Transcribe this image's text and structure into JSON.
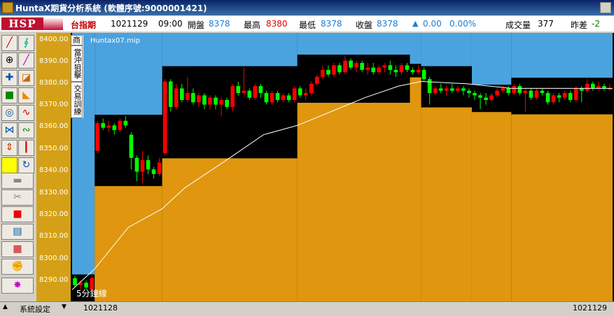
{
  "window": {
    "title": "HuntaX期貨分析系統 (軟體序號:9000001421)"
  },
  "info": {
    "logo": "HSP",
    "symbol": "台指期",
    "date": "1021129",
    "time": "09:00",
    "open_label": "開盤",
    "open": "8378",
    "high_label": "最高",
    "high": "8380",
    "low_label": "最低",
    "low": "8378",
    "close_label": "收盤",
    "close": "8378",
    "change": "0.00",
    "change_pct": "0.00%",
    "volume_label": "成交量",
    "volume": "377",
    "prevdiff_label": "昨差",
    "prevdiff": "-2"
  },
  "chart_label": "Huntax07.mip",
  "interval_label": "5分鐘線",
  "side_buttons": [
    "商",
    "當沖狙擊",
    "交易訓練"
  ],
  "y_ticks": [
    "8400.00",
    "8390.00",
    "8380.00",
    "8370.00",
    "8360.00",
    "8350.00",
    "8340.00",
    "8330.00",
    "8320.00",
    "8310.00",
    "8300.00",
    "8290.00"
  ],
  "bottom": {
    "settings": "系統設定",
    "start_date": "1021128",
    "end_date": "1021129"
  },
  "colors": {
    "up": "#ff0000",
    "down": "#00ff00",
    "orange": "#e0960e",
    "blue": "#4aa3df",
    "avg": "#ffffff"
  },
  "toolbar_icons": [
    "trend-line-icon",
    "fib-icon",
    "zoom-icon",
    "pencil-icon",
    "crosshair-icon",
    "eraser-icon",
    "lock-icon",
    "color-icon",
    "rotate-icon",
    "wave-icon",
    "drawing-icon",
    "cycle-icon",
    "up-down-icon",
    "candle-icon",
    "yellow-square-icon",
    "refresh-icon",
    "folder-icon",
    "scissors-icon",
    "stop-icon",
    "notes-icon",
    "calendar-icon",
    "gloves-icon",
    "burst-icon"
  ],
  "chart_data": {
    "type": "candlestick",
    "ylim": [
      8286,
      8402
    ],
    "y_ticks": [
      8400,
      8390,
      8380,
      8370,
      8360,
      8350,
      8340,
      8330,
      8320,
      8310,
      8300,
      8290
    ],
    "candles": [
      [
        8296,
        8293,
        8297,
        8292
      ],
      [
        8293,
        8294,
        8295,
        8291
      ],
      [
        8294,
        8292,
        8295,
        8291
      ],
      [
        8291,
        8296,
        8297,
        8290
      ],
      [
        8351,
        8363,
        8364,
        8350
      ],
      [
        8363,
        8361,
        8365,
        8360
      ],
      [
        8361,
        8362,
        8364,
        8359
      ],
      [
        8362,
        8360,
        8363,
        8358
      ],
      [
        8360,
        8364,
        8365,
        8359
      ],
      [
        8364,
        8362,
        8366,
        8361
      ],
      [
        8358,
        8348,
        8359,
        8343
      ],
      [
        8348,
        8342,
        8349,
        8338
      ],
      [
        8342,
        8347,
        8351,
        8337
      ],
      [
        8347,
        8343,
        8349,
        8341
      ],
      [
        8343,
        8341,
        8344,
        8339
      ],
      [
        8341,
        8346,
        8348,
        8340
      ],
      [
        8350,
        8381,
        8382,
        8349
      ],
      [
        8381,
        8370,
        8382,
        8368
      ],
      [
        8370,
        8378,
        8380,
        8369
      ],
      [
        8378,
        8373,
        8380,
        8372
      ],
      [
        8373,
        8376,
        8383,
        8372
      ],
      [
        8376,
        8372,
        8378,
        8371
      ],
      [
        8372,
        8375,
        8376,
        8370
      ],
      [
        8375,
        8371,
        8376,
        8369
      ],
      [
        8371,
        8374,
        8375,
        8369
      ],
      [
        8374,
        8371,
        8375,
        8369
      ],
      [
        8371,
        8373,
        8374,
        8366
      ],
      [
        8373,
        8370,
        8374,
        8369
      ],
      [
        8370,
        8379,
        8380,
        8368
      ],
      [
        8379,
        8376,
        8381,
        8375
      ],
      [
        8376,
        8377,
        8387,
        8375
      ],
      [
        8377,
        8374,
        8378,
        8373
      ],
      [
        8374,
        8379,
        8380,
        8373
      ],
      [
        8379,
        8376,
        8380,
        8374
      ],
      [
        8376,
        8372,
        8377,
        8371
      ],
      [
        8372,
        8376,
        8377,
        8371
      ],
      [
        8376,
        8373,
        8377,
        8372
      ],
      [
        8373,
        8375,
        8376,
        8372
      ],
      [
        8375,
        8373,
        8376,
        8372
      ],
      [
        8373,
        8378,
        8379,
        8372
      ],
      [
        8378,
        8375,
        8379,
        8374
      ],
      [
        8375,
        8376,
        8378,
        8373
      ],
      [
        8376,
        8380,
        8381,
        8375
      ],
      [
        8380,
        8383,
        8384,
        8379
      ],
      [
        8383,
        8386,
        8388,
        8382
      ],
      [
        8386,
        8384,
        8388,
        8383
      ],
      [
        8384,
        8388,
        8389,
        8383
      ],
      [
        8388,
        8385,
        8389,
        8384
      ],
      [
        8385,
        8390,
        8392,
        8384
      ],
      [
        8390,
        8387,
        8391,
        8386
      ],
      [
        8387,
        8389,
        8390,
        8385
      ],
      [
        8389,
        8386,
        8390,
        8385
      ],
      [
        8386,
        8387,
        8389,
        8384
      ],
      [
        8387,
        8385,
        8389,
        8384
      ],
      [
        8385,
        8387,
        8388,
        8384
      ],
      [
        8387,
        8388,
        8389,
        8385
      ],
      [
        8388,
        8386,
        8390,
        8384
      ],
      [
        8386,
        8385,
        8388,
        8383
      ],
      [
        8385,
        8388,
        8389,
        8384
      ],
      [
        8388,
        8386,
        8389,
        8385
      ],
      [
        8386,
        8385,
        8387,
        8384
      ],
      [
        8385,
        8386,
        8388,
        8384
      ],
      [
        8386,
        8382,
        8387,
        8381
      ],
      [
        8382,
        8376,
        8383,
        8371
      ],
      [
        8376,
        8378,
        8379,
        8375
      ],
      [
        8378,
        8377,
        8380,
        8376
      ],
      [
        8377,
        8378,
        8379,
        8375
      ],
      [
        8378,
        8377,
        8380,
        8376
      ],
      [
        8377,
        8378,
        8379,
        8376
      ],
      [
        8378,
        8377,
        8379,
        8375
      ],
      [
        8377,
        8376,
        8378,
        8374
      ],
      [
        8376,
        8375,
        8377,
        8373
      ],
      [
        8375,
        8374,
        8376,
        8369
      ],
      [
        8374,
        8373,
        8376,
        8371
      ],
      [
        8373,
        8375,
        8376,
        8372
      ],
      [
        8375,
        8377,
        8378,
        8374
      ],
      [
        8377,
        8378,
        8379,
        8376
      ],
      [
        8378,
        8376,
        8379,
        8375
      ],
      [
        8376,
        8379,
        8380,
        8375
      ],
      [
        8379,
        8376,
        8380,
        8375
      ],
      [
        8376,
        8377,
        8378,
        8368
      ],
      [
        8377,
        8374,
        8378,
        8373
      ],
      [
        8374,
        8377,
        8378,
        8373
      ],
      [
        8377,
        8376,
        8378,
        8375
      ],
      [
        8376,
        8372,
        8377,
        8371
      ],
      [
        8372,
        8375,
        8376,
        8371
      ],
      [
        8375,
        8374,
        8376,
        8372
      ],
      [
        8374,
        8376,
        8377,
        8373
      ],
      [
        8376,
        8373,
        8377,
        8372
      ],
      [
        8373,
        8378,
        8379,
        8372
      ],
      [
        8378,
        8377,
        8379,
        8372
      ],
      [
        8377,
        8380,
        8382,
        8376
      ],
      [
        8380,
        8378,
        8381,
        8377
      ],
      [
        8378,
        8379,
        8381,
        8377
      ],
      [
        8379,
        8378,
        8380,
        8377
      ],
      [
        8378,
        8378,
        8380,
        8377
      ]
    ],
    "segments": [
      {
        "from": 0,
        "to": 4,
        "base": 8297
      },
      {
        "from": 4,
        "to": 16,
        "base": 8399
      },
      {
        "from": 16,
        "to": 40,
        "base": 8399
      },
      {
        "from": 40,
        "to": 60,
        "base": 8399
      },
      {
        "from": 60,
        "to": 62,
        "base": 8399
      },
      {
        "from": 62,
        "to": 71,
        "base": 8399
      },
      {
        "from": 71,
        "to": 78,
        "base": 8399
      },
      {
        "from": 78,
        "to": 96,
        "base": 8399
      }
    ],
    "avg_line": [
      [
        0,
        8291
      ],
      [
        4,
        8300
      ],
      [
        10,
        8318
      ],
      [
        16,
        8326
      ],
      [
        20,
        8335
      ],
      [
        28,
        8348
      ],
      [
        34,
        8358
      ],
      [
        40,
        8362
      ],
      [
        46,
        8368
      ],
      [
        52,
        8374
      ],
      [
        58,
        8379
      ],
      [
        62,
        8381
      ],
      [
        70,
        8380
      ],
      [
        78,
        8378
      ],
      [
        88,
        8378
      ],
      [
        96,
        8378
      ]
    ]
  }
}
